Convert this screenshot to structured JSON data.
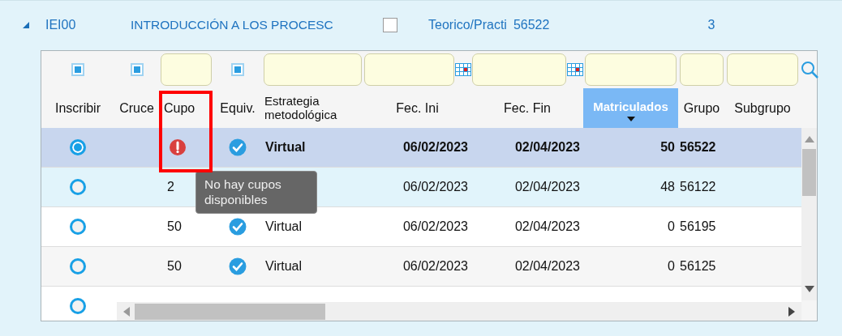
{
  "course": {
    "expanded": true,
    "code": "IEI00",
    "name": "INTRODUCCIÓN A LOS PROCESC",
    "checked": false,
    "type": "Teorico/Practi",
    "group": "56522",
    "count": "3"
  },
  "filters": [
    {
      "kind": "check"
    },
    {
      "kind": "check"
    },
    {
      "kind": "input"
    },
    {
      "kind": "check"
    },
    {
      "kind": "input"
    },
    {
      "kind": "date"
    },
    {
      "kind": "date"
    },
    {
      "kind": "input"
    },
    {
      "kind": "input"
    },
    {
      "kind": "input"
    }
  ],
  "columns": [
    {
      "label": "Inscribir",
      "sorted": false
    },
    {
      "label": "Cruce",
      "sorted": false
    },
    {
      "label": "Cupo",
      "sorted": false
    },
    {
      "label": "Equiv.",
      "sorted": false
    },
    {
      "label": "Estrategia metodológica",
      "sorted": false
    },
    {
      "label": "Fec. Ini",
      "sorted": false
    },
    {
      "label": "Fec. Fin",
      "sorted": false
    },
    {
      "label": "Matriculados",
      "sorted": true
    },
    {
      "label": "Grupo",
      "sorted": false
    },
    {
      "label": "Subgrupo",
      "sorted": false
    }
  ],
  "rows": [
    {
      "selected": true,
      "hovered": false,
      "full": true,
      "equiv": true,
      "strategy": "Virtual",
      "fec_ini": "06/02/2023",
      "fec_fin": "02/04/2023",
      "matriculados": "50",
      "grupo": "56522"
    },
    {
      "selected": false,
      "hovered": true,
      "full": false,
      "cupo": "2",
      "fec_ini": "06/02/2023",
      "fec_fin": "02/04/2023",
      "matriculados": "48",
      "grupo": "56122"
    },
    {
      "selected": false,
      "hovered": false,
      "full": false,
      "cupo": "50",
      "equiv": true,
      "strategy": "Virtual",
      "fec_ini": "06/02/2023",
      "fec_fin": "02/04/2023",
      "matriculados": "0",
      "grupo": "56195"
    },
    {
      "selected": false,
      "hovered": false,
      "full": false,
      "cupo": "50",
      "equiv": true,
      "strategy": "Virtual",
      "fec_ini": "06/02/2023",
      "fec_fin": "02/04/2023",
      "matriculados": "0",
      "grupo": "56125"
    },
    {
      "selected": false,
      "hovered": false
    }
  ],
  "tooltip": "No hay cupos disponibles"
}
